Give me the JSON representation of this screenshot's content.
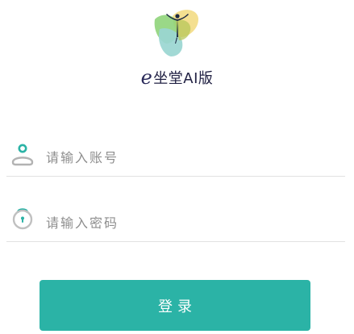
{
  "app": {
    "brand_prefix": "e",
    "brand_name": "坐堂AI版"
  },
  "form": {
    "account": {
      "placeholder": "请输入账号",
      "value": "",
      "icon": "user-icon"
    },
    "password": {
      "placeholder": "请输入密码",
      "value": "",
      "icon": "lock-icon"
    },
    "login_label": "登录"
  },
  "colors": {
    "accent": "#2bb3a6",
    "logo_green": "#7fcf6e",
    "logo_yellow": "#f3d46b",
    "logo_teal": "#9ad6d1",
    "brand_text": "#222244"
  }
}
